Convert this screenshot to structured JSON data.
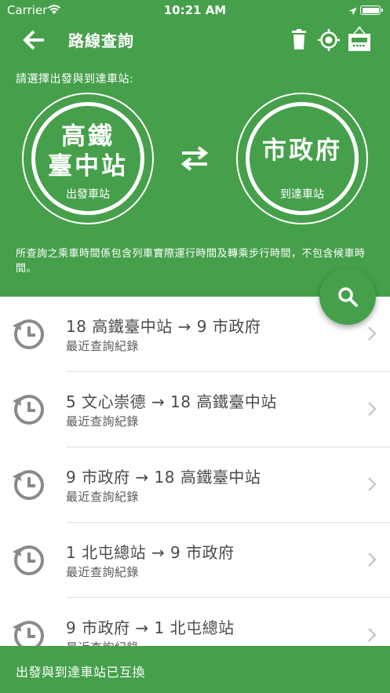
{
  "status_bar": {
    "carrier": "Carrier",
    "time": "10:21 AM"
  },
  "nav": {
    "title": "路線查詢"
  },
  "instruction": "請選擇出發與到達車站:",
  "from_station": {
    "name_line1": "高鐵",
    "name_line2": "臺中站",
    "role": "出發車站"
  },
  "to_station": {
    "name": "市政府",
    "role": "到達車站"
  },
  "notice": "所查詢之乘車時間係包含列車實際運行時間及轉乘步行時間，不包含候車時間。",
  "history": [
    {
      "title": "18 高鐵臺中站 → 9 市政府",
      "subtitle": "最近查詢紀錄"
    },
    {
      "title": "5 文心崇德 → 18 高鐵臺中站",
      "subtitle": "最近查詢紀錄"
    },
    {
      "title": "9 市政府 → 18 高鐵臺中站",
      "subtitle": "最近查詢紀錄"
    },
    {
      "title": "1 北屯總站 → 9 市政府",
      "subtitle": "最近查詢紀錄"
    },
    {
      "title": "9 市政府 → 1 北屯總站",
      "subtitle": "最近查詢紀錄"
    }
  ],
  "toast": "出發與到達車站已互換",
  "icons": {
    "back": "arrow-left-icon",
    "trash": "trash-icon",
    "locate": "crosshair-icon",
    "hotel": "hotel-sign-icon",
    "swap": "swap-arrows-icon",
    "search": "search-icon",
    "history": "history-clock-icon",
    "chevron": "chevron-right-icon"
  },
  "colors": {
    "primary_green": "#46a04b",
    "text_dark": "#4a4a4a",
    "icon_gray": "#8a8a8a"
  }
}
